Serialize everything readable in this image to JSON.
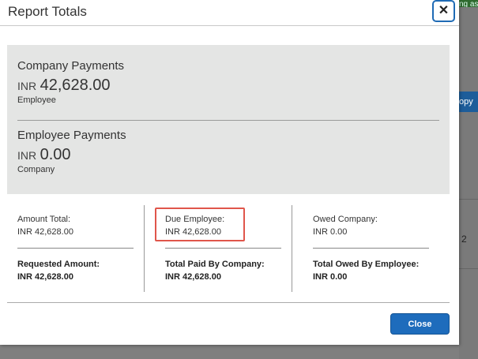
{
  "modal": {
    "title": "Report Totals",
    "close_icon": "✕"
  },
  "summary": {
    "company_payments": {
      "title": "Company Payments",
      "currency": "INR",
      "amount": "42,628.00",
      "sub": "Employee"
    },
    "employee_payments": {
      "title": "Employee Payments",
      "currency": "INR",
      "amount": "0.00",
      "sub": "Company"
    }
  },
  "columns": [
    {
      "label": "Amount Total:",
      "amount": "INR 42,628.00",
      "bold_label": "Requested Amount:",
      "bold_amount": "INR 42,628.00"
    },
    {
      "label": "Due Employee:",
      "amount": "INR 42,628.00",
      "bold_label": "Total Paid By Company:",
      "bold_amount": "INR 42,628.00"
    },
    {
      "label": "Owed Company:",
      "amount": "INR 0.00",
      "bold_label": "Total Owed By Employee:",
      "bold_amount": "INR 0.00"
    }
  ],
  "footer": {
    "close_label": "Close"
  },
  "background": {
    "top_text": "ng as",
    "button_text": "opy",
    "number_text": "2"
  },
  "colors": {
    "accent": "#1e6cbc",
    "highlight": "#e0564b",
    "panel": "#e4e5e4"
  }
}
